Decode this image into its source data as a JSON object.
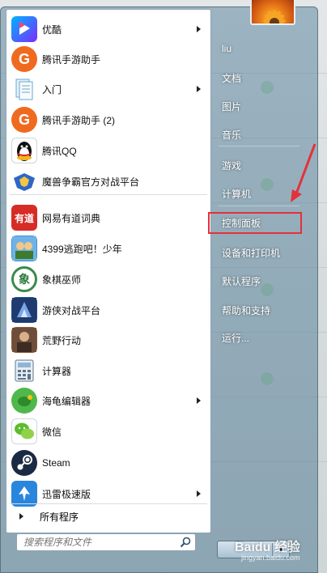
{
  "programs": [
    {
      "label": "优酷",
      "icon": "youku-icon",
      "color": "#1e8ef2",
      "glyph": "YOUKU",
      "has_arrow": true
    },
    {
      "label": "腾讯手游助手",
      "icon": "tencent-game-assistant-icon",
      "color": "#ef6a1f",
      "glyph": "G",
      "has_arrow": false
    },
    {
      "label": "入门",
      "icon": "getting-started-icon",
      "color": "#6aa7cf",
      "glyph": "",
      "has_arrow": true
    },
    {
      "label": "腾讯手游助手 (2)",
      "icon": "tencent-game-assistant-icon",
      "color": "#ef6a1f",
      "glyph": "G",
      "has_arrow": false
    },
    {
      "label": "腾讯QQ",
      "icon": "qq-penguin-icon",
      "color": "#ffffff",
      "glyph": "",
      "has_arrow": false
    },
    {
      "label": "魔兽争霸官方对战平台",
      "icon": "warcraft-platform-icon",
      "color": "#3b4a6b",
      "glyph": "",
      "has_arrow": false
    },
    {
      "label": "网易有道词典",
      "icon": "youdao-dictionary-icon",
      "color": "#d72c26",
      "glyph": "有道",
      "has_arrow": false
    },
    {
      "label": "4399逃跑吧！少年",
      "icon": "game-4399-icon",
      "color": "#4a8fd0",
      "glyph": "",
      "has_arrow": false
    },
    {
      "label": "象棋巫师",
      "icon": "chess-icon",
      "color": "#3c8a4a",
      "glyph": "象",
      "has_arrow": false
    },
    {
      "label": "游侠对战平台",
      "icon": "youxia-platform-icon",
      "color": "#2a4c8c",
      "glyph": "",
      "has_arrow": false
    },
    {
      "label": "荒野行动",
      "icon": "knives-out-icon",
      "color": "#8a5a3a",
      "glyph": "",
      "has_arrow": false
    },
    {
      "label": "计算器",
      "icon": "calculator-icon",
      "color": "#6d8aa5",
      "glyph": "",
      "has_arrow": false
    },
    {
      "label": "海龟编辑器",
      "icon": "turtle-editor-icon",
      "color": "#4fb84a",
      "glyph": "",
      "has_arrow": true
    },
    {
      "label": "微信",
      "icon": "wechat-icon",
      "color": "#ffffff",
      "glyph": "",
      "has_arrow": false
    },
    {
      "label": "Steam",
      "icon": "steam-icon",
      "color": "#1a2a44",
      "glyph": "",
      "has_arrow": false
    },
    {
      "label": "迅雷极速版",
      "icon": "xunlei-icon",
      "color": "#2a86dd",
      "glyph": "",
      "has_arrow": true
    }
  ],
  "all_programs_label": "所有程序",
  "search_placeholder": "搜索程序和文件",
  "right_items": [
    {
      "label": "liu"
    },
    {
      "label": "文档"
    },
    {
      "label": "图片"
    },
    {
      "label": "音乐"
    },
    {
      "label": "游戏"
    },
    {
      "label": "计算机"
    },
    {
      "label": "控制面板"
    },
    {
      "label": "设备和打印机"
    },
    {
      "label": "默认程序"
    },
    {
      "label": "帮助和支持"
    },
    {
      "label": "运行..."
    }
  ],
  "watermark": {
    "text": "Baidu 经验",
    "sub": "jingyan.baidu.com"
  },
  "colors": {
    "highlight": "#e5313b",
    "menu_glass": "#6289a3"
  }
}
